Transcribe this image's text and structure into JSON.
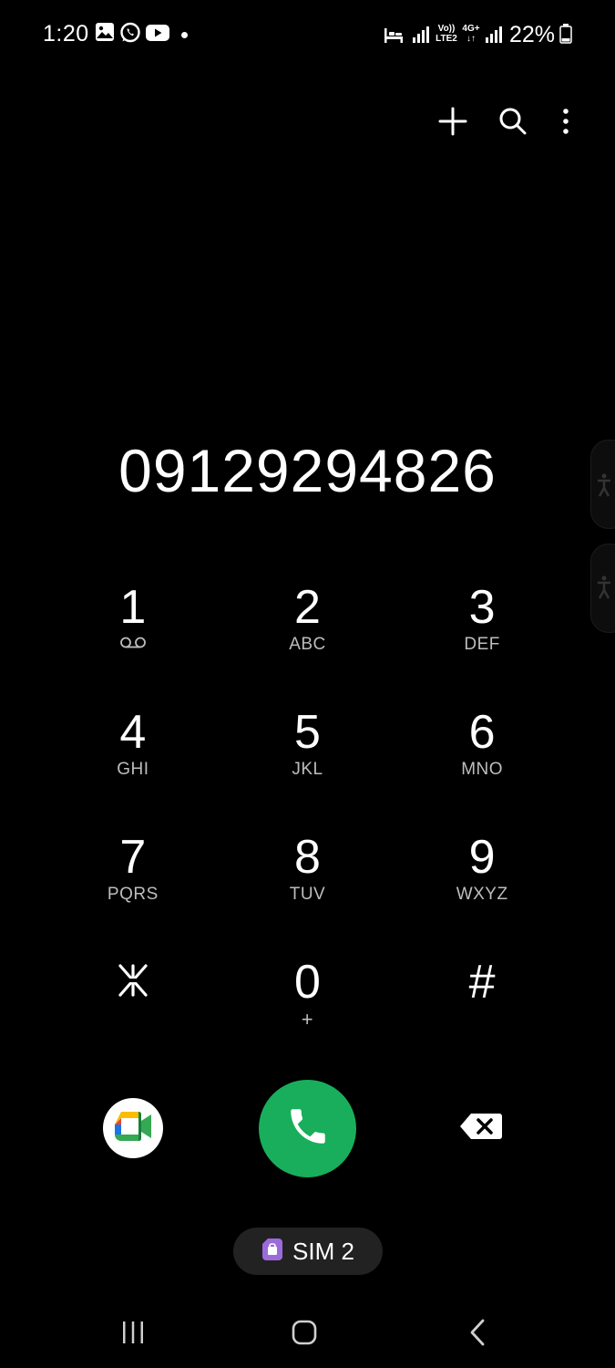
{
  "status_bar": {
    "time": "1:20",
    "notification_icons": [
      "gallery-icon",
      "whatsapp-icon",
      "youtube-icon"
    ],
    "network_labels": {
      "volte_top": "Vo))",
      "volte_bottom": "LTE2",
      "data_type": "4G+"
    },
    "battery_percent": "22%"
  },
  "actions": {
    "add_icon": "plus-icon",
    "search_icon": "search-icon",
    "more_icon": "more-vertical-icon"
  },
  "dialer": {
    "number": "09129294826"
  },
  "keypad": {
    "keys": [
      {
        "digit": "1",
        "letters": "",
        "sub_icon": "voicemail-icon"
      },
      {
        "digit": "2",
        "letters": "ABC"
      },
      {
        "digit": "3",
        "letters": "DEF"
      },
      {
        "digit": "4",
        "letters": "GHI"
      },
      {
        "digit": "5",
        "letters": "JKL"
      },
      {
        "digit": "6",
        "letters": "MNO"
      },
      {
        "digit": "7",
        "letters": "PQRS"
      },
      {
        "digit": "8",
        "letters": "TUV"
      },
      {
        "digit": "9",
        "letters": "WXYZ"
      },
      {
        "digit": "⁎",
        "letters": ""
      },
      {
        "digit": "0",
        "letters": "+"
      },
      {
        "digit": "#",
        "letters": ""
      }
    ]
  },
  "bottom_actions": {
    "video_call_icon": "google-meet-icon",
    "call_icon": "phone-icon",
    "backspace_icon": "backspace-icon"
  },
  "sim": {
    "label": "SIM 2",
    "color": "#9b6bdc"
  },
  "colors": {
    "background": "#000000",
    "call_green": "#19ae5c",
    "chip_background": "#222222"
  },
  "nav_bar": {
    "recents_icon": "recents-icon",
    "home_icon": "home-icon",
    "back_icon": "back-icon"
  }
}
